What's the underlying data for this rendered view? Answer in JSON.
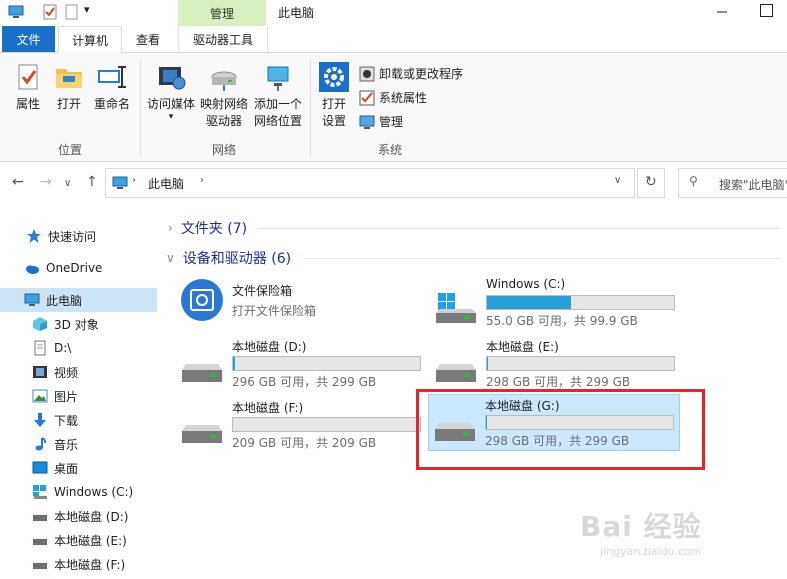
{
  "window": {
    "title": "此电脑",
    "context_tab": "管理"
  },
  "tabs": {
    "file": "文件",
    "computer": "计算机",
    "view": "查看",
    "drive_tools": "驱动器工具"
  },
  "ribbon": {
    "location": {
      "label": "位置",
      "properties": "属性",
      "open": "打开",
      "rename": "重命名"
    },
    "network": {
      "label": "网络",
      "access_media": "访问媒体",
      "map_drive_1": "映射网络",
      "map_drive_2": "驱动器",
      "add_location_1": "添加一个",
      "add_location_2": "网络位置"
    },
    "system": {
      "label": "系统",
      "open_settings_1": "打开",
      "open_settings_2": "设置",
      "uninstall": "卸载或更改程序",
      "sys_props": "系统属性",
      "manage": "管理"
    }
  },
  "address": {
    "path": "此电脑",
    "search_placeholder": "搜索\"此电脑\""
  },
  "sidebar": {
    "items": [
      {
        "label": "快速访问",
        "icon": "star-icon"
      },
      {
        "label": "OneDrive",
        "icon": "cloud-icon"
      },
      {
        "label": "此电脑",
        "icon": "computer-icon"
      },
      {
        "label": "3D 对象",
        "icon": "cube-icon"
      },
      {
        "label": "D:\\",
        "icon": "document-icon"
      },
      {
        "label": "视频",
        "icon": "film-icon"
      },
      {
        "label": "图片",
        "icon": "picture-icon"
      },
      {
        "label": "下载",
        "icon": "download-icon"
      },
      {
        "label": "音乐",
        "icon": "music-icon"
      },
      {
        "label": "桌面",
        "icon": "desktop-icon"
      },
      {
        "label": "Windows (C:)",
        "icon": "windows-drive-icon"
      },
      {
        "label": "本地磁盘 (D:)",
        "icon": "drive-icon"
      },
      {
        "label": "本地磁盘 (E:)",
        "icon": "drive-icon"
      },
      {
        "label": "本地磁盘 (F:)",
        "icon": "drive-icon"
      }
    ]
  },
  "main": {
    "folders_section": "文件夹 (7)",
    "devices_section": "设备和驱动器 (6)",
    "vault": {
      "name": "文件保险箱",
      "desc": "打开文件保险箱"
    },
    "drives": [
      {
        "name": "Windows (C:)",
        "free": "55.0 GB 可用，共 99.9 GB",
        "used_fraction": 0.45,
        "accent": "#26a0da"
      },
      {
        "name": "本地磁盘 (D:)",
        "free": "296 GB 可用，共 299 GB",
        "used_fraction": 0.01
      },
      {
        "name": "本地磁盘 (E:)",
        "free": "298 GB 可用，共 299 GB",
        "used_fraction": 0.003
      },
      {
        "name": "本地磁盘 (F:)",
        "free": "209 GB 可用，共 209 GB",
        "used_fraction": 0.0
      },
      {
        "name": "本地磁盘 (G:)",
        "free": "298 GB 可用，共 299 GB",
        "used_fraction": 0.003
      }
    ]
  },
  "watermark": {
    "brand": "Bai 经验",
    "url": "jingyan.baidu.com"
  }
}
